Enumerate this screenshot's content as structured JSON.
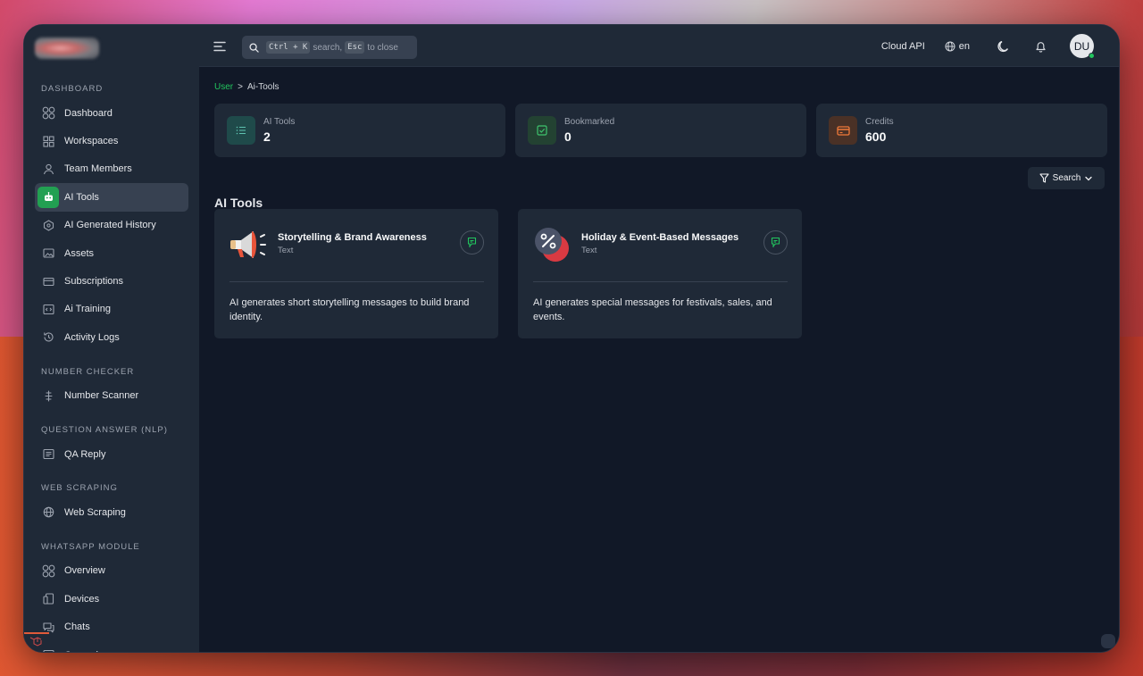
{
  "search": {
    "kbd1": "Ctrl + K",
    "mid": "search,",
    "kbd2": "Esc",
    "tail": "to close"
  },
  "topbar": {
    "cloud_api": "Cloud API",
    "lang": "en",
    "avatar": "DU"
  },
  "sidebar": {
    "sections": [
      {
        "title": "DASHBOARD",
        "items": [
          {
            "label": "Dashboard",
            "icon": "grid-icon"
          },
          {
            "label": "Workspaces",
            "icon": "workspace-icon"
          },
          {
            "label": "Team Members",
            "icon": "user-icon"
          },
          {
            "label": "AI Tools",
            "icon": "robot-icon",
            "active": true
          },
          {
            "label": "AI Generated History",
            "icon": "ai-history-icon"
          },
          {
            "label": "Assets",
            "icon": "image-icon"
          },
          {
            "label": "Subscriptions",
            "icon": "card-icon"
          },
          {
            "label": "Ai Training",
            "icon": "code-icon"
          },
          {
            "label": "Activity Logs",
            "icon": "history-icon"
          }
        ]
      },
      {
        "title": "NUMBER CHECKER",
        "items": [
          {
            "label": "Number Scanner",
            "icon": "scanner-icon"
          }
        ]
      },
      {
        "title": "QUESTION ANSWER (NLP)",
        "items": [
          {
            "label": "QA Reply",
            "icon": "reply-icon"
          }
        ]
      },
      {
        "title": "WEB SCRAPING",
        "items": [
          {
            "label": "Web Scraping",
            "icon": "globe-icon"
          }
        ]
      },
      {
        "title": "WHATSAPP MODULE",
        "items": [
          {
            "label": "Overview",
            "icon": "grid-icon"
          },
          {
            "label": "Devices",
            "icon": "devices-icon"
          },
          {
            "label": "Chats",
            "icon": "chat-icon"
          },
          {
            "label": "Campaigns",
            "icon": "campaign-icon"
          }
        ]
      }
    ]
  },
  "breadcrumb": {
    "root": "User",
    "sep": ">",
    "current": "Ai-Tools"
  },
  "stats": [
    {
      "label": "AI Tools",
      "value": "2",
      "icon": "list-icon",
      "bg": "#1f4a4a",
      "fg": "#5ec2b0"
    },
    {
      "label": "Bookmarked",
      "value": "0",
      "icon": "check-icon",
      "bg": "#234232",
      "fg": "#3ec46d"
    },
    {
      "label": "Credits",
      "value": "600",
      "icon": "credit-card-icon",
      "bg": "#4a3126",
      "fg": "#f07a3a"
    }
  ],
  "section": {
    "title": "AI Tools",
    "filter_label": "Search"
  },
  "tools": [
    {
      "title": "Storytelling & Brand Awareness",
      "type": "Text",
      "desc": "AI generates short storytelling messages to build brand identity.",
      "image": "megaphone-icon"
    },
    {
      "title": "Holiday & Event-Based Messages",
      "type": "Text",
      "desc": "AI generates special messages for festivals, sales, and events.",
      "image": "discount-badge-icon"
    }
  ]
}
